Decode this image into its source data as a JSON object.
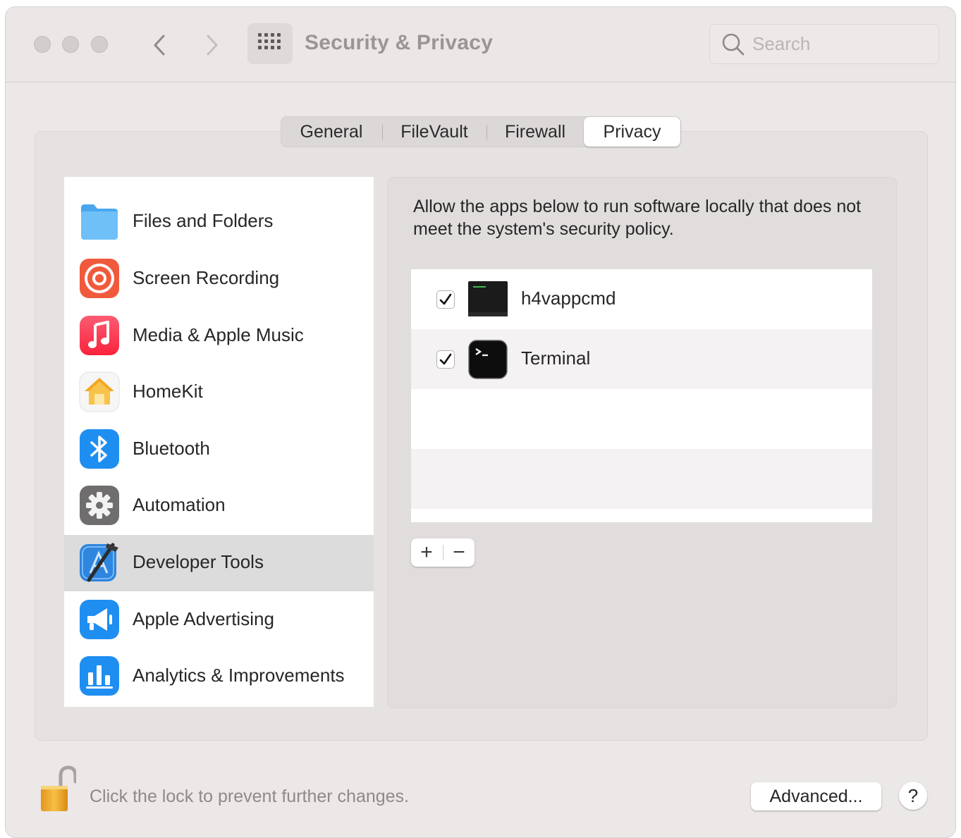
{
  "window": {
    "title": "Security & Privacy",
    "search_placeholder": "Search"
  },
  "tabs": [
    {
      "label": "General"
    },
    {
      "label": "FileVault"
    },
    {
      "label": "Firewall"
    },
    {
      "label": "Privacy",
      "selected": true
    }
  ],
  "sidebar": {
    "items": [
      {
        "label": "Files and Folders",
        "icon": "folder-icon"
      },
      {
        "label": "Screen Recording",
        "icon": "screen-recording-icon"
      },
      {
        "label": "Media & Apple Music",
        "icon": "music-note-icon"
      },
      {
        "label": "HomeKit",
        "icon": "home-icon"
      },
      {
        "label": "Bluetooth",
        "icon": "bluetooth-icon"
      },
      {
        "label": "Automation",
        "icon": "gear-icon"
      },
      {
        "label": "Developer Tools",
        "icon": "developer-tools-icon",
        "selected": true
      },
      {
        "label": "Apple Advertising",
        "icon": "megaphone-icon"
      },
      {
        "label": "Analytics & Improvements",
        "icon": "bar-chart-icon"
      }
    ]
  },
  "pane": {
    "description": "Allow the apps below to run software locally that does not meet the system's security policy.",
    "apps": [
      {
        "name": "h4vappcmd",
        "checked": true,
        "icon": "console-app-icon"
      },
      {
        "name": "Terminal",
        "checked": true,
        "icon": "terminal-icon"
      }
    ],
    "add_label": "+",
    "remove_label": "−"
  },
  "footer": {
    "lock_text": "Click the lock to prevent further changes.",
    "advanced_label": "Advanced...",
    "help_label": "?"
  },
  "colors": {
    "window_bg": "#ece8e8",
    "selected_row": "#dcdcdc",
    "folder_blue": "#5eb4f3",
    "accent_blue": "#1d7ff2"
  }
}
